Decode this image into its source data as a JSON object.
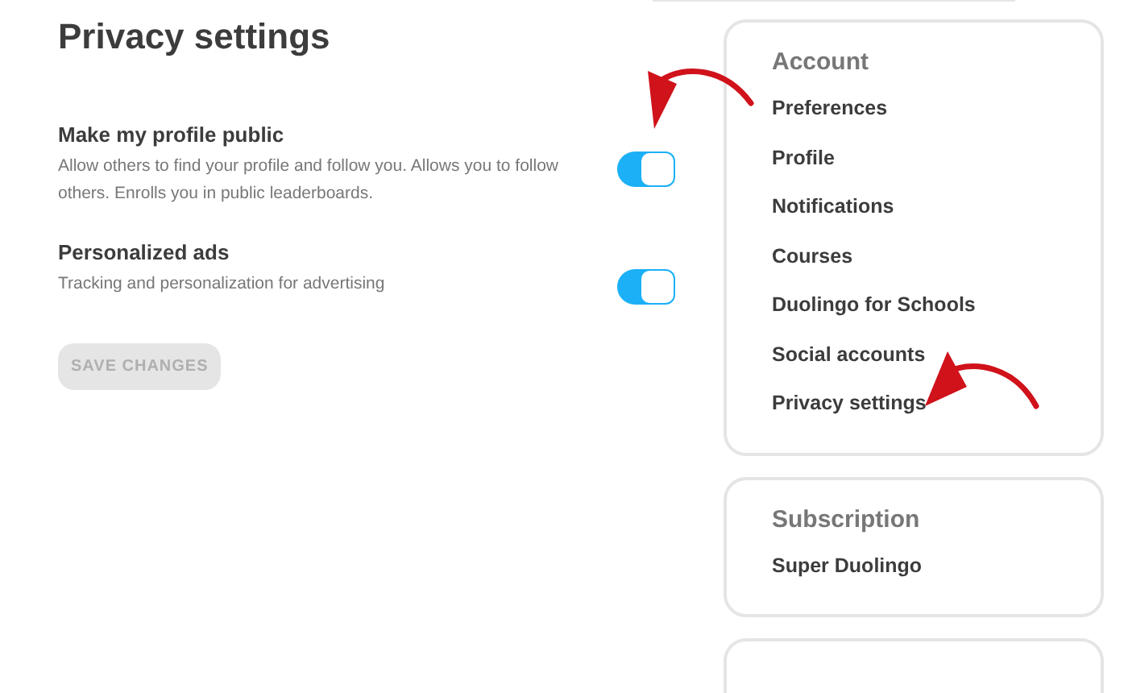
{
  "title": "Privacy settings",
  "settings": [
    {
      "label": "Make my profile public",
      "description": "Allow others to find your profile and follow you. Allows you to follow others. Enrolls you in public leaderboards.",
      "on": true
    },
    {
      "label": "Personalized ads",
      "description": "Tracking and personalization for advertising",
      "on": true
    }
  ],
  "save_button": {
    "label": "SAVE CHANGES",
    "disabled": true
  },
  "sidebar": [
    {
      "heading": "Account",
      "items": [
        {
          "label": "Preferences"
        },
        {
          "label": "Profile"
        },
        {
          "label": "Notifications"
        },
        {
          "label": "Courses"
        },
        {
          "label": "Duolingo for Schools"
        },
        {
          "label": "Social accounts"
        },
        {
          "label": "Privacy settings"
        }
      ]
    },
    {
      "heading": "Subscription",
      "items": [
        {
          "label": "Super Duolingo"
        }
      ]
    }
  ]
}
